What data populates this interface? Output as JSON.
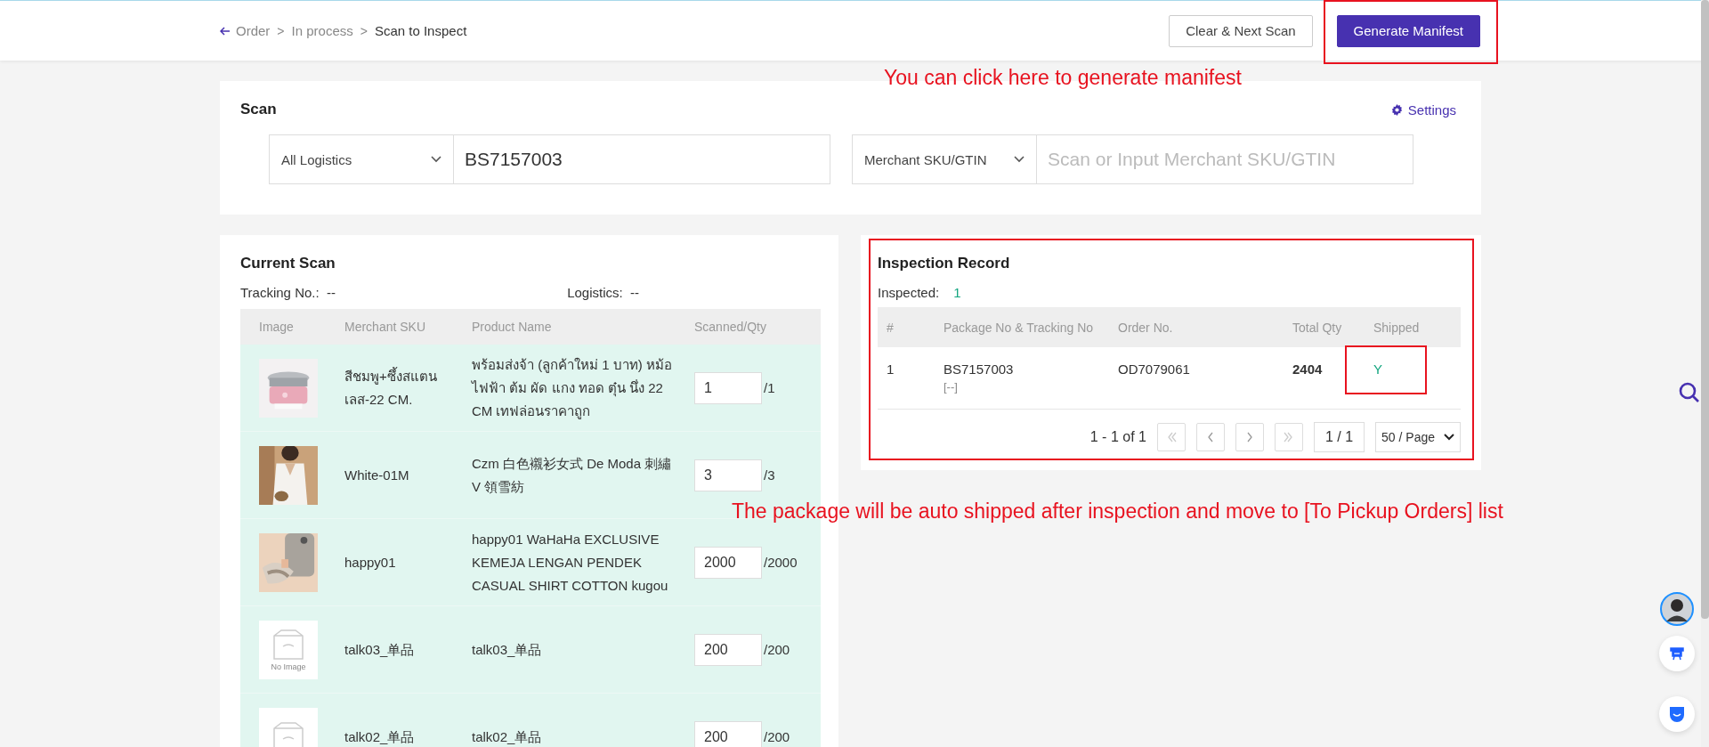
{
  "breadcrumb": [
    {
      "kind": "back",
      "label": "Order"
    },
    {
      "kind": "link",
      "separator": ">",
      "label": "In process"
    },
    {
      "kind": "current",
      "separator": ">",
      "label": "Scan to Inspect"
    }
  ],
  "header_buttons": [
    {
      "kind": "outline",
      "label": "Clear & Next Scan"
    },
    {
      "kind": "primary",
      "label": "Generate Manifest"
    }
  ],
  "scan": {
    "title": "Scan",
    "settings": "Settings",
    "logistics_select": "All Logistics",
    "tracking_value": "BS7157003",
    "sku_select": "Merchant SKU/GTIN",
    "sku_placeholder": "Scan or Input Merchant SKU/GTIN"
  },
  "current_scan": {
    "title": "Current Scan",
    "tracking_label": "Tracking No.:",
    "tracking_value": "--",
    "logistics_label": "Logistics:",
    "logistics_value": "--",
    "columns": [
      "Image",
      "Merchant SKU",
      "Product Name",
      "Scanned/Qty"
    ],
    "rows": [
      {
        "image": {
          "kind": "pot"
        },
        "sku": "สีชมพู+ซึ้งสแตนเลส-22 CM.",
        "product": "พร้อมส่งจ้า (ลูกค้าใหม่ 1 บาท) หม้อไฟฟ้า ต้ม ผัด แกง ทอด ตุ๋น นึ่ง 22 CM เทฟล่อนราคาถูก",
        "scanned": "1",
        "qty": "/1"
      },
      {
        "image": {
          "kind": "blouse"
        },
        "sku": "White-01M",
        "product": "Czm 白色襯衫女式 De Moda 刺繡 V 領雪紡",
        "scanned": "3",
        "qty": "/3"
      },
      {
        "image": {
          "kind": "case"
        },
        "sku": "happy01",
        "product": "happy01 WaHaHa EXCLUSIVE KEMEJA LENGAN PENDEK CASUAL SHIRT COTTON kugou",
        "scanned": "2000",
        "qty": "/2000"
      },
      {
        "image": {
          "kind": "none",
          "label": "No Image"
        },
        "sku": "talk03_单品",
        "product": "talk03_单品",
        "scanned": "200",
        "qty": "/200"
      },
      {
        "image": {
          "kind": "none"
        },
        "sku": "talk02_单品",
        "product": "talk02_单品",
        "scanned": "200",
        "qty": "/200"
      }
    ]
  },
  "inspection": {
    "title": "Inspection Record",
    "inspected_label": "Inspected:",
    "inspected_value": "1",
    "columns": [
      "#",
      "Package No & Tracking No",
      "Order No.",
      "Total Qty",
      "Shipped"
    ],
    "rows": [
      {
        "index": "1",
        "package": "BS7157003",
        "tracking": "[--]",
        "order": "OD7079061",
        "total": "2404",
        "shipped": "Y"
      }
    ],
    "pagination": {
      "range": "1 - 1 of 1",
      "page": "1 / 1",
      "page_size": "50 / Page"
    }
  },
  "annotations": [
    {
      "text": "You can click here to generate manifest"
    },
    {
      "text": "The package will be auto shipped after inspection and move to [To Pickup Orders] list"
    }
  ]
}
